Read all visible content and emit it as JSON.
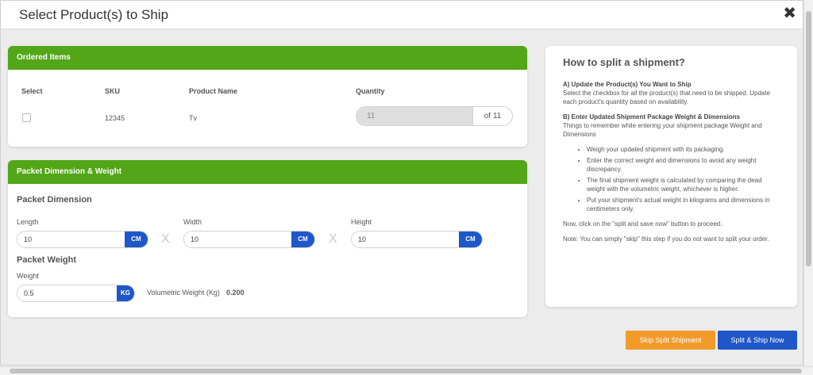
{
  "modal": {
    "title": "Select Product(s) to Ship",
    "close_glyph": "✖"
  },
  "ordered_items": {
    "header": "Ordered Items",
    "columns": [
      "Select",
      "SKU",
      "Product Name",
      "Quantity"
    ],
    "rows": [
      {
        "sku": "12345",
        "product_name": "Tv",
        "quantity": "11",
        "of_label": "of 11"
      }
    ]
  },
  "packet": {
    "header": "Packet Dimension & Weight",
    "dimension_title": "Packet Dimension",
    "length_label": "Length",
    "length_value": "10",
    "length_unit": "CM",
    "width_label": "Width",
    "width_value": "10",
    "width_unit": "CM",
    "height_label": "Height",
    "height_value": "10",
    "height_unit": "CM",
    "separator": "X",
    "weight_title": "Packet Weight",
    "weight_label": "Weight",
    "weight_value": "0.5",
    "weight_unit": "KG",
    "volumetric_label": "Volumetric Weight (Kg)",
    "volumetric_value": "0.200"
  },
  "help": {
    "title": "How to split a shipment?",
    "step_a_title": "A) Update the Product(s) You Want to Ship",
    "step_a_text": "Select the checkbox for all the product(s) that need to be shipped. Update each product's quantity based on availability.",
    "step_b_title": "B) Enter Updated Shipment Package Weight & Dimensions",
    "step_b_text": "Things to remember while entering your shipment package Weight and Dimensions",
    "bullets": [
      "Weigh your updated shipment with its packaging.",
      "Enter the correct weight and dimensions to avoid any weight discrepancy.",
      "The final shipment weight is calculated by comparing the dead weight with the volumetric weight, whichever is higher.",
      "Put your shipment's actual weight in kilograms and dimensions in centimeters only."
    ],
    "proceed_text": "Now, click on the \"split and save now\" button to proceed.",
    "note_text": "Note: You can simply \"skip\" this step if you do not want to split your order."
  },
  "actions": {
    "skip_label": "Skip Split Shipment",
    "split_label": "Split & Ship Now"
  },
  "colors": {
    "header_green": "#52a617",
    "unit_blue": "#1f57c8",
    "skip_orange": "#f39a2a"
  }
}
